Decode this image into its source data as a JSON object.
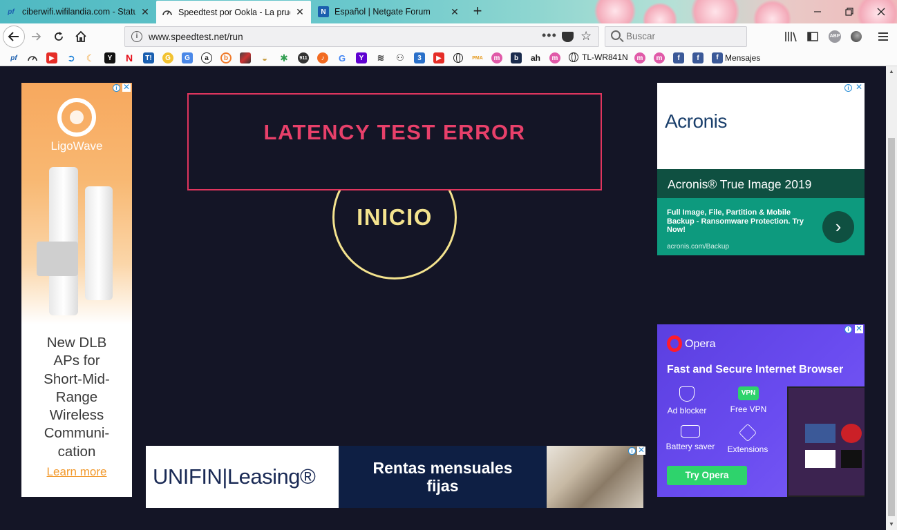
{
  "browser": {
    "tabs": [
      {
        "title": "ciberwifi.wifilandia.com - Status",
        "favicon": "pf",
        "active": false
      },
      {
        "title": "Speedtest por Ookla - La prueba",
        "favicon": "speed-gauge",
        "active": true
      },
      {
        "title": "Español | Netgate Forum",
        "favicon": "N",
        "active": false
      }
    ],
    "url": "www.speedtest.net/run",
    "search_placeholder": "Buscar",
    "bookmarks": {
      "tplink_label": "TL-WR841N",
      "mensajes_label": "Mensajes",
      "icon_labels": {
        "y": "Y",
        "n": "N",
        "t": "T!",
        "a": "a",
        "n911": "911",
        "ah": "ah"
      }
    }
  },
  "speedtest": {
    "error_message": "LATENCY TEST ERROR",
    "go_label": "INICIO",
    "colors": {
      "background": "#141526",
      "error": "#e8406a",
      "go": "#f4e38e"
    }
  },
  "ads": {
    "ligowave": {
      "brand": "LigoWave",
      "copy": [
        "New DLB",
        "APs for",
        "Short-Mid-",
        "Range",
        "Wireless",
        "Communi-",
        "cation"
      ],
      "cta": "Learn more"
    },
    "acronis": {
      "logo": "Acronis",
      "product": "Acronis® True Image 2019",
      "description": "Full Image, File, Partition & Mobile Backup - Ransomware Protection. Try Now!",
      "domain": "acronis.com/Backup"
    },
    "opera": {
      "brand": "Opera",
      "headline": "Fast and Secure Internet Browser",
      "features": [
        "Ad blocker",
        "Free VPN",
        "Battery saver",
        "Extensions"
      ],
      "vpn_badge": "VPN",
      "cta": "Try Opera"
    },
    "unifin": {
      "brand": "UNIFIN|Leasing®",
      "tagline": [
        "Rentas mensuales",
        "fijas"
      ]
    }
  }
}
